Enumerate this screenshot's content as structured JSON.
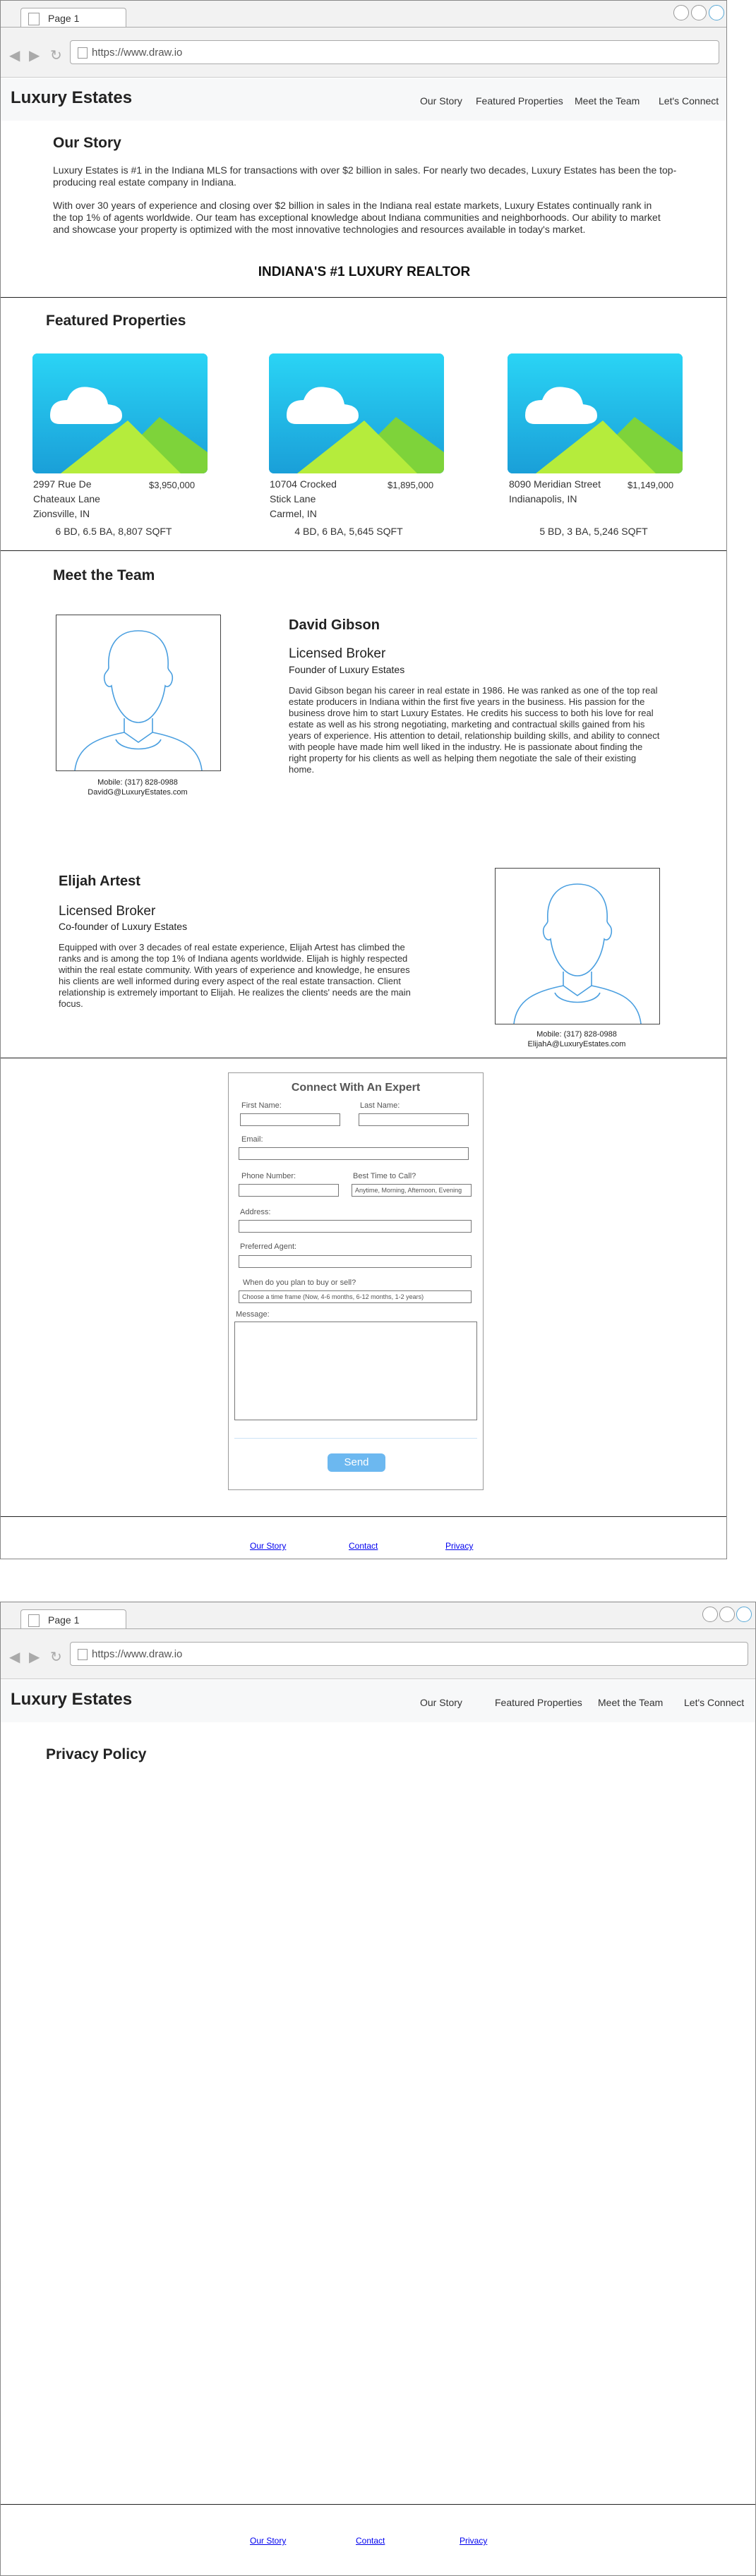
{
  "browser": {
    "tab_label": "Page 1",
    "url": "https://www.draw.io"
  },
  "navbar": {
    "brand": "Luxury Estates",
    "links": [
      "Our Story",
      "Featured Properties",
      "Meet the Team",
      "Let's Connect"
    ]
  },
  "our_story": {
    "title": "Our Story",
    "para1": "Luxury Estates is #1  in the Indiana MLS for transactions with over $2 billion in sales. For nearly two decades, Luxury Estates has been the top-producing real estate company in Indiana.",
    "para2": "With over 30 years of experience and closing over $2 billion in sales in the Indiana real estate markets, Luxury Estates continually rank in the top 1% of agents worldwide. Our team has exceptional knowledge about Indiana communities and neighborhoods. Our ability to market and showcase your property is optimized with the most innovative technologies and resources available in today's market.",
    "tagline": "INDIANA'S #1 LUXURY REALTOR"
  },
  "featured": {
    "title": "Featured Properties",
    "properties": [
      {
        "address1": "2997 Rue De",
        "address2": "Chateaux Lane",
        "city": "Zionsville, IN",
        "price": "$3,950,000",
        "details": "6 BD, 6.5 BA, 8,807 SQFT"
      },
      {
        "address1": "10704 Crocked",
        "address2": "Stick Lane",
        "city": "Carmel, IN",
        "price": "$1,895,000",
        "details": "4 BD, 6 BA, 5,645 SQFT"
      },
      {
        "address1": "8090 Meridian Street",
        "address2": "Indianapolis, IN",
        "city": "",
        "price": "$1,149,000",
        "details": "5 BD, 3 BA, 5,246 SQFT"
      }
    ]
  },
  "team": {
    "title": "Meet the Team",
    "members": [
      {
        "name": "David Gibson",
        "role": "Licensed Broker",
        "position": "Founder of Luxury Estates",
        "bio": "David Gibson began his career in real estate in 1986. He was ranked as one of the top real estate producers in Indiana within the first five years in the business. His passion for the business drove him to start Luxury Estates. He credits his success to both his love for real estate as well as his strong negotiating, marketing and contractual skills gained from his years of experience. His attention to detail, relationship building skills, and ability to connect with people have made him well liked in the industry. He is passionate about finding the right property for his clients as well as helping them negotiate the sale of their existing home.",
        "mobile": "Mobile: (317) 828-0988",
        "email": "DavidG@LuxuryEstates.com"
      },
      {
        "name": "Elijah Artest",
        "role": "Licensed Broker",
        "position": "Co-founder of Luxury Estates",
        "bio": "Equipped with over 3 decades of real estate experience, Elijah Artest has climbed the ranks and is among the top 1% of Indiana agents worldwide. Elijah is highly respected within the real estate community. With years of experience and knowledge, he ensures his clients are well informed during every aspect of the real estate transaction. Client relationship is extremely important to Elijah. He realizes the clients' needs are the main focus.",
        "mobile": "Mobile: (317) 828-0988",
        "email": "ElijahA@LuxuryEstates.com"
      }
    ]
  },
  "contact_form": {
    "title": "Connect With An Expert",
    "first_name": "First Name:",
    "last_name": "Last Name:",
    "email": "Email:",
    "phone": "Phone Number:",
    "best_time": "Best Time to Call?",
    "best_time_placeholder": "Anytime, Morning, Afternoon, Evening",
    "address": "Address:",
    "agent": "Preferred Agent:",
    "plan": "When do you plan to buy or sell?",
    "plan_placeholder": "Choose a time frame (Now, 4-6 months, 6-12 months, 1-2 years)",
    "message": "Message:",
    "send": "Send"
  },
  "footer": {
    "links": [
      "Our Story",
      "Contact",
      "Privacy"
    ]
  },
  "privacy_page": {
    "title": "Privacy Policy"
  }
}
